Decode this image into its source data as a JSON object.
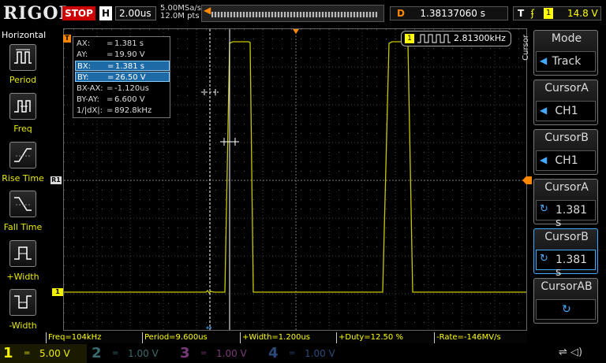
{
  "header": {
    "brand": "RIGOL",
    "run_state": "STOP",
    "timebase_label": "H",
    "timebase_value": "2.00us",
    "sample_rate": "5.00MSa/s",
    "memory_depth": "12.0M pts",
    "delay_label": "D",
    "delay_value": "1.38137060 s",
    "trigger_label": "T",
    "trigger_edge_icon": "rising-edge-icon",
    "trigger_source": "1",
    "trigger_level": "14.8 V"
  },
  "left_menu": {
    "title": "Horizontal",
    "items": [
      {
        "label": "Period",
        "icon": "period-icon"
      },
      {
        "label": "Freq",
        "icon": "freq-icon"
      },
      {
        "label": "Rise Time",
        "icon": "rise-time-icon"
      },
      {
        "label": "Fall Time",
        "icon": "fall-time-icon"
      },
      {
        "label": "+Width",
        "icon": "pos-width-icon"
      },
      {
        "label": "-Width",
        "icon": "neg-width-icon"
      }
    ]
  },
  "cursor_readout": {
    "rows": [
      {
        "key": "AX:",
        "eq": "=",
        "value": "1.381 s"
      },
      {
        "key": "AY:",
        "eq": "=",
        "value": "19.90 V"
      },
      {
        "key": "BX:",
        "eq": "=",
        "value": "1.381 s"
      },
      {
        "key": "BY:",
        "eq": "=",
        "value": "26.50 V"
      },
      {
        "key": "BX-AX:",
        "eq": "=",
        "value": "-1.120us"
      },
      {
        "key": "BY-AY:",
        "eq": "=",
        "value": "6.600 V"
      },
      {
        "key": "1/|dX|:",
        "eq": "=",
        "value": "892.8kHz"
      }
    ]
  },
  "frequency_counter": {
    "channel": "1",
    "value": "2.81300kHz"
  },
  "markers": {
    "ch1_ref": "1",
    "trigger_marker": "T",
    "cursor_ref": "R1"
  },
  "measurements": [
    "Freq=104kHz",
    "Period=9.600us",
    "+Width=1.200us",
    "+Duty=12.50 %",
    "-Rate=-146MV/s"
  ],
  "channels": [
    {
      "num": "1",
      "coupling": "=",
      "scale": "5.00 V",
      "color": "#f0f000"
    },
    {
      "num": "2",
      "coupling": "=",
      "scale": "1.00 V",
      "color": "#00d8ff"
    },
    {
      "num": "3",
      "coupling": "=",
      "scale": "1.00 V",
      "color": "#ff40ff"
    },
    {
      "num": "4",
      "coupling": "=",
      "scale": "1.00 V",
      "color": "#2080ff"
    }
  ],
  "right_menu": {
    "vertical_title": "Cursor",
    "mode": {
      "title": "Mode",
      "value": "Track"
    },
    "cursor_a_source": {
      "title": "CursorA",
      "value": "CH1"
    },
    "cursor_b_source": {
      "title": "CursorB",
      "value": "CH1"
    },
    "cursor_a_pos": {
      "title": "CursorA",
      "value": "1.381 s"
    },
    "cursor_b_pos": {
      "title": "CursorB",
      "value": "1.381 s"
    },
    "cursor_ab": {
      "title": "CursorAB"
    }
  },
  "status_icons": [
    "usb-icon",
    "speaker-icon"
  ],
  "colors": {
    "ch1": "#f0f000",
    "accent": "#ff8000",
    "highlight": "#1e6aa6",
    "stop": "#cc0000"
  }
}
